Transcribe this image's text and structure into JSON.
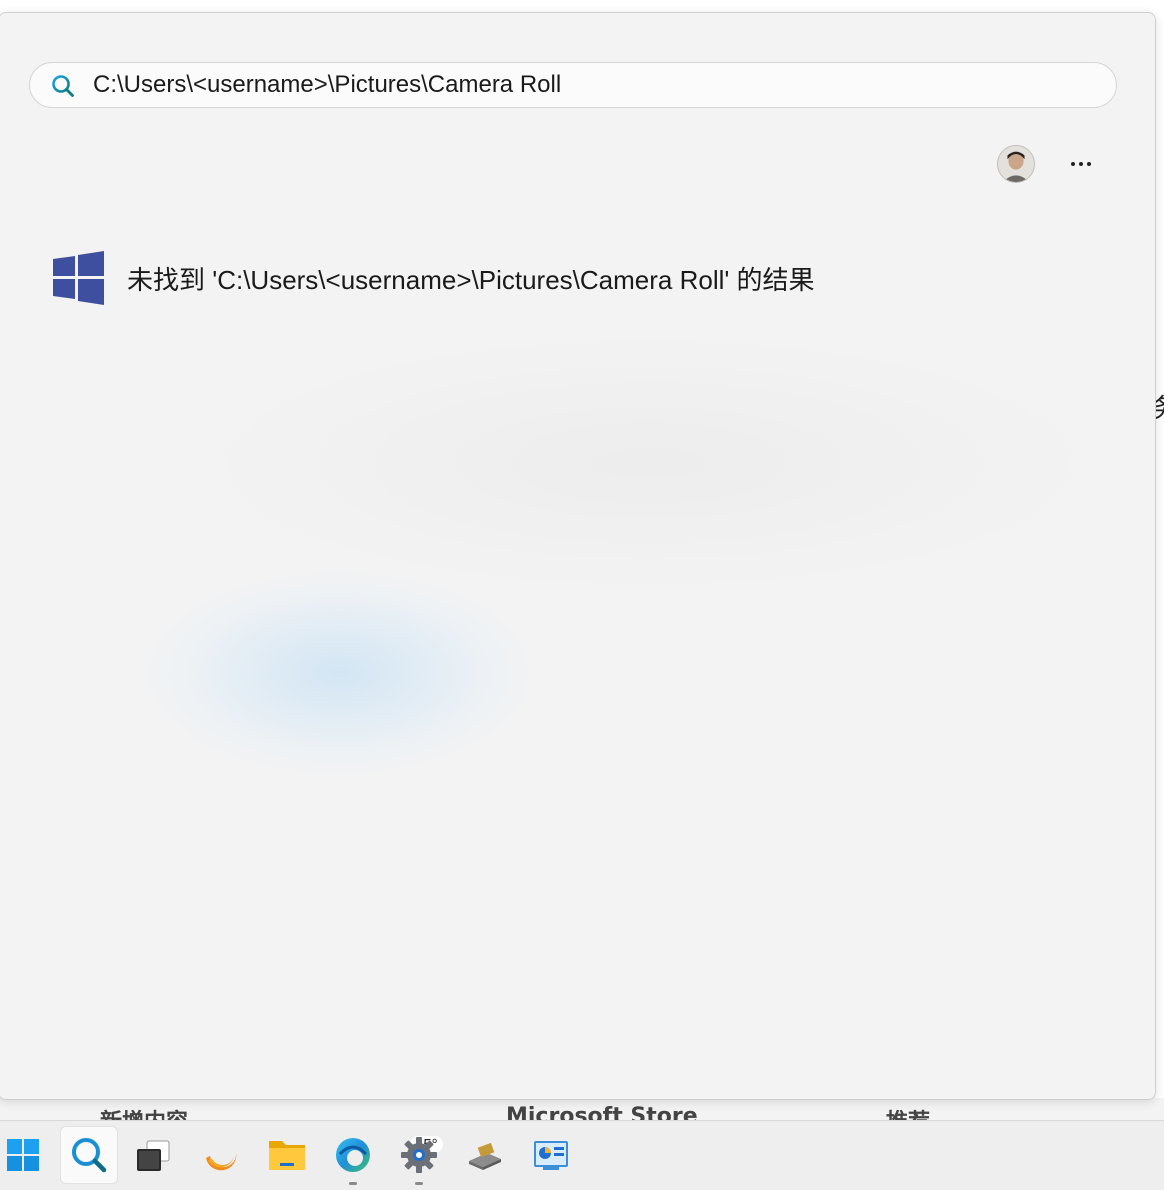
{
  "search": {
    "query": "C:\\Users\\<username>\\Pictures\\Camera Roll"
  },
  "results": {
    "no_results_message": "未找到 'C:\\Users\\<username>\\Pictures\\Camera Roll' 的结果"
  },
  "header": {
    "more_icon": "more-horizontal-icon",
    "avatar_icon": "user-avatar"
  },
  "background": {
    "bottom_labels": [
      "新增内容",
      "Microsoft Store",
      "推荐"
    ],
    "right_glyph": "务"
  },
  "taskbar": {
    "items": [
      {
        "name": "start",
        "icon": "windows-start-icon"
      },
      {
        "name": "search",
        "icon": "search-icon",
        "active": true
      },
      {
        "name": "task-view",
        "icon": "task-view-icon"
      },
      {
        "name": "weather",
        "icon": "weather-icon",
        "label": "15°"
      },
      {
        "name": "file-explorer",
        "icon": "folder-icon"
      },
      {
        "name": "edge",
        "icon": "edge-browser-icon",
        "running": true
      },
      {
        "name": "settings",
        "icon": "gear-icon",
        "running": true
      },
      {
        "name": "app",
        "icon": "app-icon"
      },
      {
        "name": "control-panel",
        "icon": "control-panel-icon"
      }
    ]
  },
  "colors": {
    "accent": "#0078d4",
    "windows_logo": "#3f4f9f",
    "panel_bg": "#f3f3f3"
  }
}
